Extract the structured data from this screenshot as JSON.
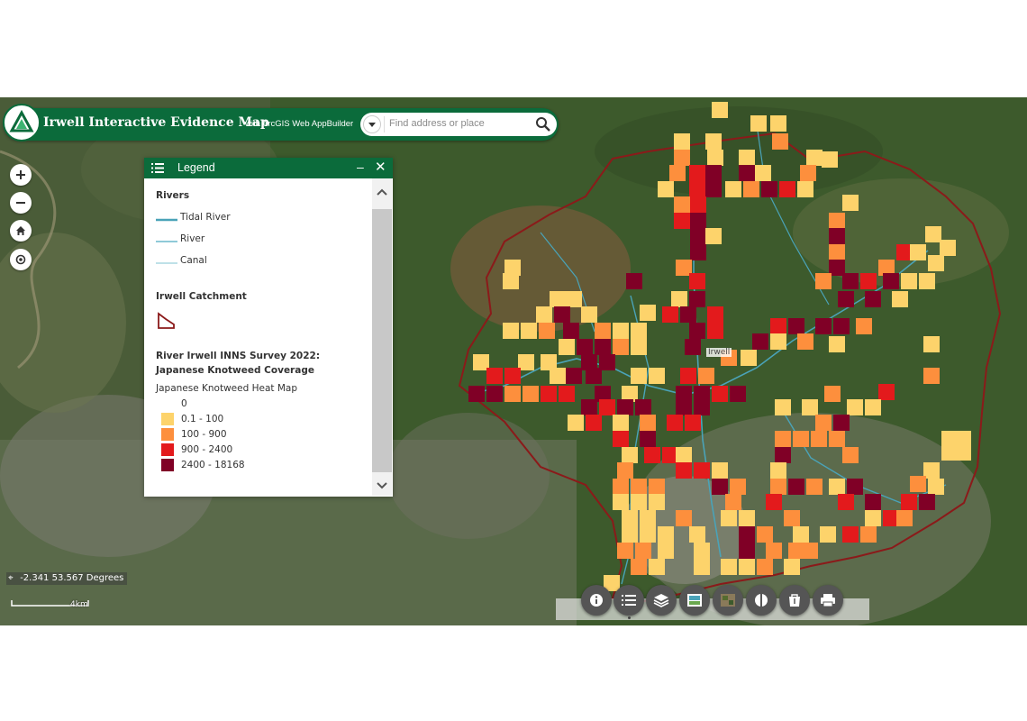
{
  "header": {
    "title": "Irwell Interactive Evidence Map",
    "subtitle": "with ArcGIS Web AppBuilder",
    "logo_icon": "triangle-logo-icon"
  },
  "search": {
    "placeholder": "Find address or place",
    "dropdown_icon": "caret-down-icon",
    "button_icon": "search-icon"
  },
  "map_tools": [
    {
      "name": "zoom-in",
      "icon": "plus-icon"
    },
    {
      "name": "zoom-out",
      "icon": "minus-icon"
    },
    {
      "name": "home",
      "icon": "home-icon"
    },
    {
      "name": "my-location",
      "icon": "locate-icon"
    }
  ],
  "legend": {
    "title": "Legend",
    "minimize": "–",
    "close": "✕",
    "groups": {
      "rivers": {
        "title": "Rivers",
        "items": [
          "Tidal River",
          "River",
          "Canal"
        ]
      },
      "catchment": {
        "title": "Irwell Catchment"
      },
      "survey": {
        "title_line1": "River Irwell INNS Survey 2022:",
        "title_line2": "Japanese Knotweed Coverage",
        "subtitle": "Japanese Knotweed Heat Map",
        "classes": [
          {
            "label": "0",
            "color": ""
          },
          {
            "label": "0.1 - 100",
            "color": "#fdd36b"
          },
          {
            "label": "100 - 900",
            "color": "#fd8f3d"
          },
          {
            "label": "900 - 2400",
            "color": "#e31a1c"
          },
          {
            "label": "2400 - 18168",
            "color": "#800026"
          }
        ]
      }
    }
  },
  "map": {
    "label": "Irwell",
    "coordinates": "-2.341 53.567 Degrees",
    "scale_label": "4km"
  },
  "toolbar": {
    "buttons": [
      "about-icon",
      "legend-icon",
      "layers-icon",
      "basemap-icon",
      "image-icon",
      "swipe-icon",
      "bookmark-icon",
      "print-icon"
    ]
  },
  "colors": {
    "brand_green": "#0b6b3b",
    "catchment_outline": "#8b1a1a",
    "river": "#4aa3b8"
  }
}
